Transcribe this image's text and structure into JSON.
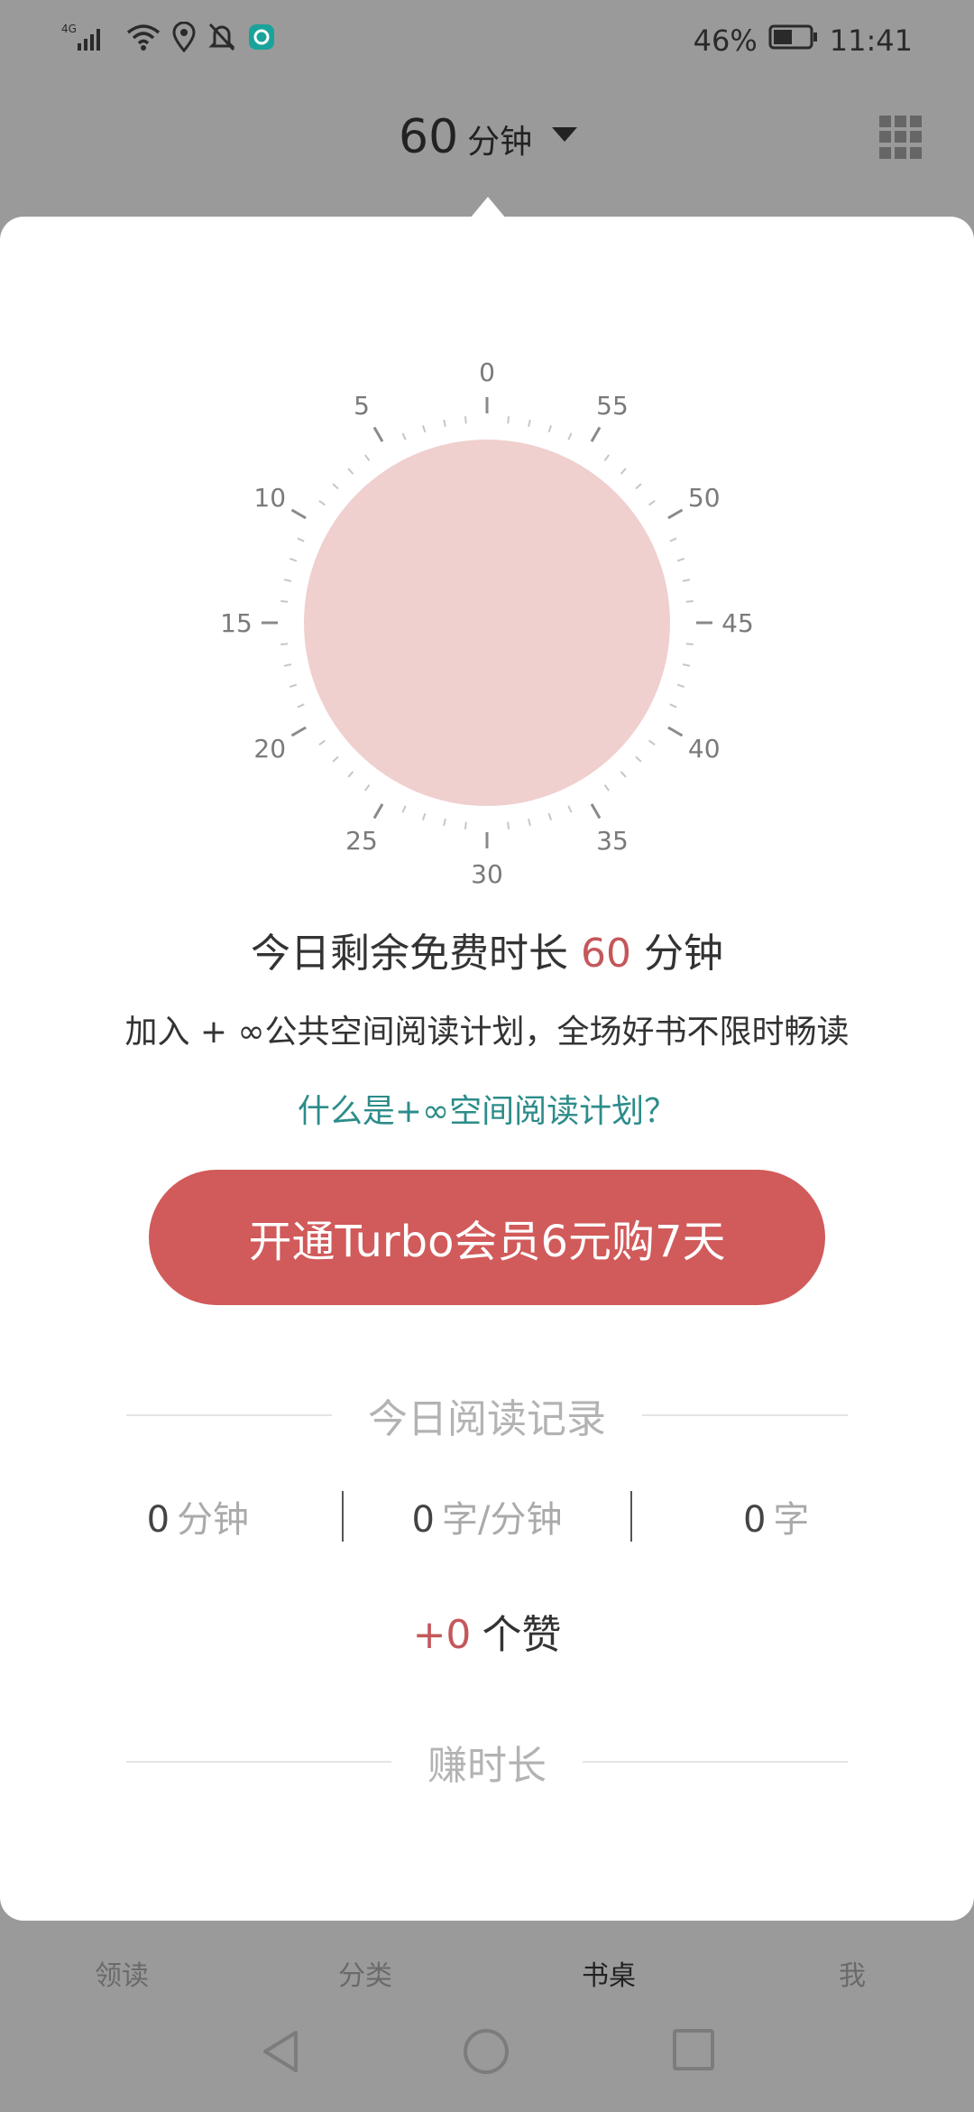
{
  "status_bar": {
    "network": "4G",
    "battery": "46%",
    "time": "11:41",
    "icons": [
      "signal-icon",
      "wifi-icon",
      "location-icon",
      "mute-icon",
      "app-icon",
      "battery-icon"
    ]
  },
  "header": {
    "timer_value": "60",
    "timer_unit": "分钟"
  },
  "dial": {
    "tick_labels": [
      "0",
      "5",
      "10",
      "15",
      "20",
      "25",
      "30",
      "35",
      "40",
      "45",
      "50",
      "55"
    ],
    "fill_color": "#f0cfcf"
  },
  "remaining": {
    "prefix": "今日剩余免费时长",
    "value": "60",
    "suffix": "分钟"
  },
  "join_text": "加入 + ∞公共空间阅读计划，全场好书不限时畅读",
  "plan_link": "什么是+∞空间阅读计划？",
  "cta_label": "开通Turbo会员6元购7天",
  "reading_record": {
    "title": "今日阅读记录",
    "minutes": {
      "value": "0",
      "unit": "分钟"
    },
    "speed": {
      "value": "0",
      "unit": "字/分钟"
    },
    "words": {
      "value": "0",
      "unit": "字"
    },
    "likes": {
      "value": "+0",
      "unit": "个赞"
    }
  },
  "earn_section_title": "赚时长",
  "bottom_tabs": [
    {
      "label": "领读",
      "icon": "book-open-icon"
    },
    {
      "label": "分类",
      "icon": "category-icon"
    },
    {
      "label": "书桌",
      "icon": "desk-icon",
      "active": true
    },
    {
      "label": "我",
      "icon": "user-icon"
    }
  ],
  "colors": {
    "accent_red": "#d15a5a",
    "link_teal": "#2c8c8a",
    "overlay_gray": "#9a9a9a"
  }
}
